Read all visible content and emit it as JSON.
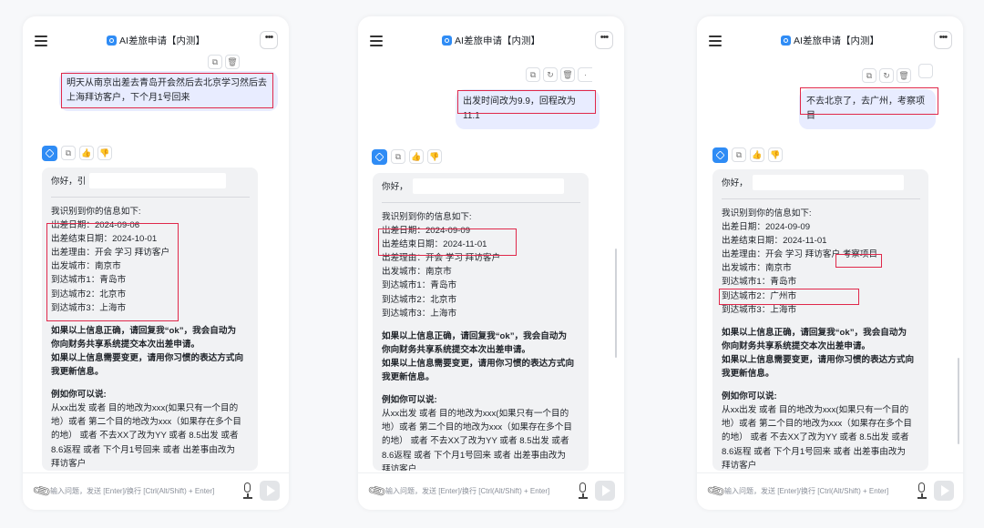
{
  "app": {
    "title": "AI差旅申请【内测】"
  },
  "input_placeholder": "输入问题，发送 [Enter]/换行 [Ctrl(Alt/Shift) + Enter]",
  "icons": {
    "menu": "menu-icon",
    "more": "more-icon",
    "copy": "copy-icon",
    "refresh": "refresh-icon",
    "delete": "delete-icon",
    "thumbs_up": "thumbs-up-icon",
    "thumbs_down": "thumbs-down-icon",
    "attach": "paperclip-icon",
    "mic": "microphone-icon",
    "send": "send-icon"
  },
  "colors": {
    "accent": "#2f8cf5",
    "user_bubble": "#e8ecff",
    "highlight_box": "#e0284a",
    "bot_bubble": "#f1f2f4"
  },
  "panels": [
    {
      "user_message": "明天从南京出差去青岛开会然后去北京学习然后去上海拜访客户，下个月1号回来",
      "greeting": "你好，引",
      "intro": "我识别到你的信息如下:",
      "info_lines": [
        "出差日期：2024-09-06",
        "出差结束日期：2024-10-01",
        "出差理由：开会 学习 拜访客户",
        "出发城市：南京市",
        "到达城市1：青岛市",
        "到达城市2：北京市",
        "到达城市3：上海市"
      ],
      "confirm_1": "如果以上信息正确，请回复我“ok”，我会自动为",
      "confirm_2": "你向财务共享系统提交本次出差申请。",
      "confirm_3": "如果以上信息需要变更，请用你习惯的表达方式向",
      "confirm_4": "我更新信息。",
      "example_title": "例如你可以说:",
      "example_lines": [
        "从xx出发 或者 目的地改为xxx(如果只有一个目的",
        "地）或者 第二个目的地改为xxx（如果存在多个目",
        "的地） 或者 不去XX了改为YY 或者 8.5出发 或者",
        "8.6返程 或者 下个月1号回来 或者 出差事由改为",
        "拜访客户"
      ]
    },
    {
      "user_message": "出发时间改为9.9，回程改为11.1",
      "greeting": "你好，",
      "intro": "我识别到你的信息如下:",
      "info_lines": [
        "出差日期：2024-09-09",
        "出差结束日期：2024-11-01",
        "出差理由：开会 学习 拜访客户",
        "出发城市：南京市",
        "到达城市1：青岛市",
        "到达城市2：北京市",
        "到达城市3：上海市"
      ],
      "confirm_1": "如果以上信息正确，请回复我“ok”，我会自动为",
      "confirm_2": "你向财务共享系统提交本次出差申请。",
      "confirm_3": "如果以上信息需要变更，请用你习惯的表达方式向",
      "confirm_4": "我更新信息。",
      "example_title": "例如你可以说:",
      "example_lines": [
        "从xx出发 或者 目的地改为xxx(如果只有一个目的",
        "地）或者 第二个目的地改为xxx（如果存在多个目",
        "的地） 或者 不去XX了改为YY 或者 8.5出发 或者",
        "8.6返程 或者 下个月1号回来 或者 出差事由改为",
        "拜访客户"
      ]
    },
    {
      "user_message": "不去北京了，去广州，考察项目",
      "greeting": "你好，",
      "intro": "我识别到你的信息如下:",
      "info_lines": [
        "出差日期：2024-09-09",
        "出差结束日期：2024-11-01",
        "出差理由：开会 学习 拜访客户 考察项目",
        "出发城市：南京市",
        "到达城市1：青岛市",
        "到达城市2：广州市",
        "到达城市3：上海市"
      ],
      "confirm_1": "如果以上信息正确，请回复我“ok”，我会自动为",
      "confirm_2": "你向财务共享系统提交本次出差申请。",
      "confirm_3": "如果以上信息需要变更，请用你习惯的表达方式向",
      "confirm_4": "我更新信息。",
      "example_title": "例如你可以说:",
      "example_lines": [
        "从xx出发 或者 目的地改为xxx(如果只有一个目的",
        "地）或者 第二个目的地改为xxx（如果存在多个目",
        "的地） 或者 不去XX了改为YY 或者 8.5出发 或者",
        "8.6返程 或者 下个月1号回来 或者 出差事由改为",
        "拜访客户"
      ]
    }
  ]
}
